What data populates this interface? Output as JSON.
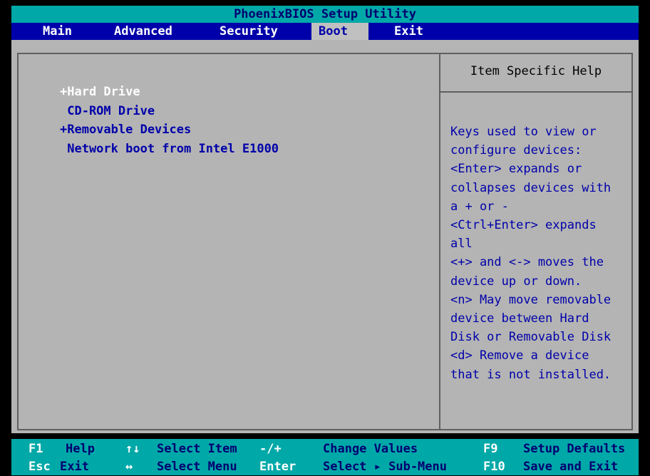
{
  "title": "PhoenixBIOS Setup Utility",
  "menu": {
    "main": "Main",
    "advanced": "Advanced",
    "security": "Security",
    "boot": "Boot",
    "exit": "Exit"
  },
  "boot_list": [
    "+Hard Drive",
    " CD-ROM Drive",
    "+Removable Devices",
    " Network boot from Intel E1000"
  ],
  "help": {
    "title": "Item Specific Help",
    "lines": [
      "Keys used to view or",
      "configure devices:",
      "<Enter> expands or",
      "collapses devices with",
      "a + or -",
      "<Ctrl+Enter> expands",
      "all",
      "<+> and <-> moves the",
      "device up or down.",
      "<n> May move removable",
      "device between Hard",
      "Disk or Removable Disk",
      "<d> Remove a device",
      "that is not installed."
    ]
  },
  "status": {
    "f1_key": "F1",
    "f1_desc": "Help",
    "updown_key": "↑↓",
    "updown_desc": "Select Item",
    "plusminus_key": "-/+",
    "plusminus_desc": "Change Values",
    "f9_key": "F9",
    "f9_desc": "Setup Defaults",
    "esc_key": "Esc",
    "esc_desc": "Exit",
    "leftright_key": "↔",
    "leftright_desc": "Select Menu",
    "enter_key": "Enter",
    "enter_desc": "Select ▸ Sub-Menu",
    "f10_key": "F10",
    "f10_desc": "Save and Exit"
  },
  "colors": {
    "title_bg": "#00A8A8",
    "menu_bg": "#0000AA",
    "panel_bg": "#B4B4B4",
    "selected_text": "#FFFFFF",
    "item_text": "#0000AA"
  }
}
